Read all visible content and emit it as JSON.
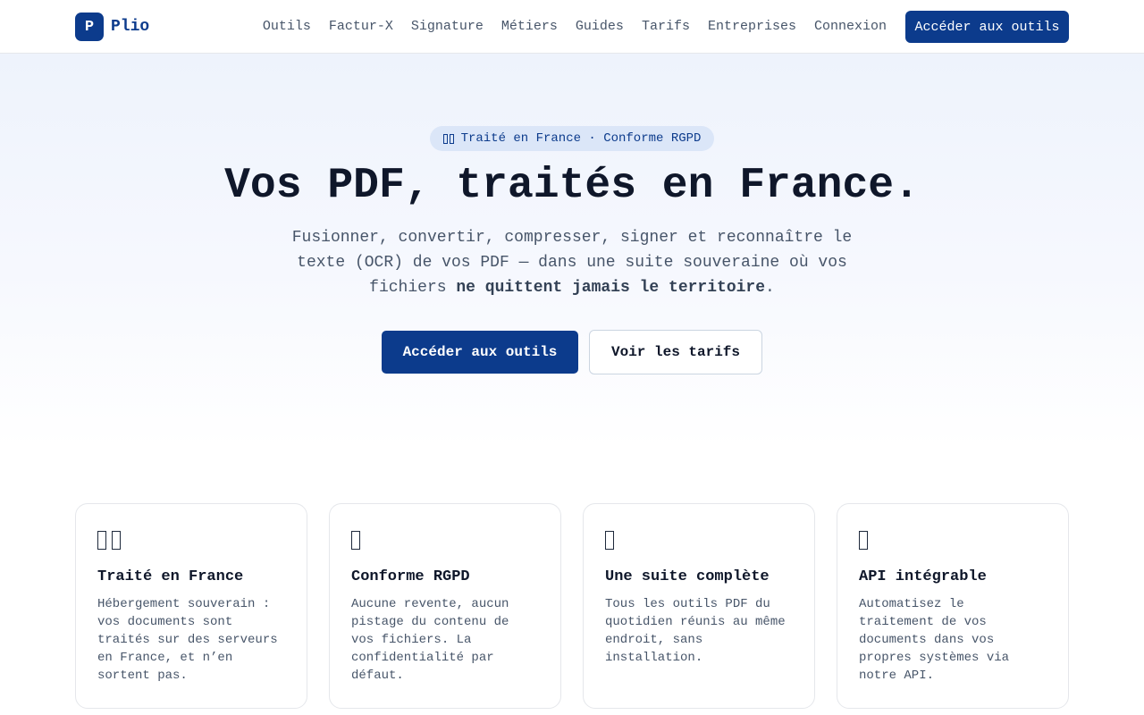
{
  "brand": {
    "logo_letter": "P",
    "name": "Plio",
    "accent_color": "#0c3b8c"
  },
  "nav": {
    "items": [
      "Outils",
      "Factur-X",
      "Signature",
      "Métiers",
      "Guides",
      "Tarifs",
      "Entreprises",
      "Connexion"
    ],
    "cta": "Accéder aux outils"
  },
  "hero": {
    "badge": "Traité en France · Conforme RGPD",
    "badge_icon": "france-flag-icon",
    "title": "Vos PDF, traités en France.",
    "subtitle_prefix": "Fusionner, convertir, compresser, signer et reconnaître le texte (OCR) de vos PDF — dans une suite souveraine où vos fichiers ",
    "subtitle_emphasis": "ne quittent jamais le territoire",
    "subtitle_suffix": ".",
    "primary_button": "Accéder aux outils",
    "secondary_button": "Voir les tarifs"
  },
  "features": [
    {
      "icon": "france-flag-icon",
      "title": "Traité en France",
      "text": "Hébergement souverain : vos documents sont traités sur des serveurs en France, et n’en sortent pas."
    },
    {
      "icon": "lock-icon",
      "title": "Conforme RGPD",
      "text": "Aucune revente, aucun pistage du contenu de vos fichiers. La confidentialité par défaut."
    },
    {
      "icon": "toolbox-icon",
      "title": "Une suite complète",
      "text": "Tous les outils PDF du quotidien réunis au même endroit, sans installation."
    },
    {
      "icon": "plug-icon",
      "title": "API intégrable",
      "text": "Automatisez le traitement de vos documents dans vos propres systèmes via notre API."
    }
  ]
}
